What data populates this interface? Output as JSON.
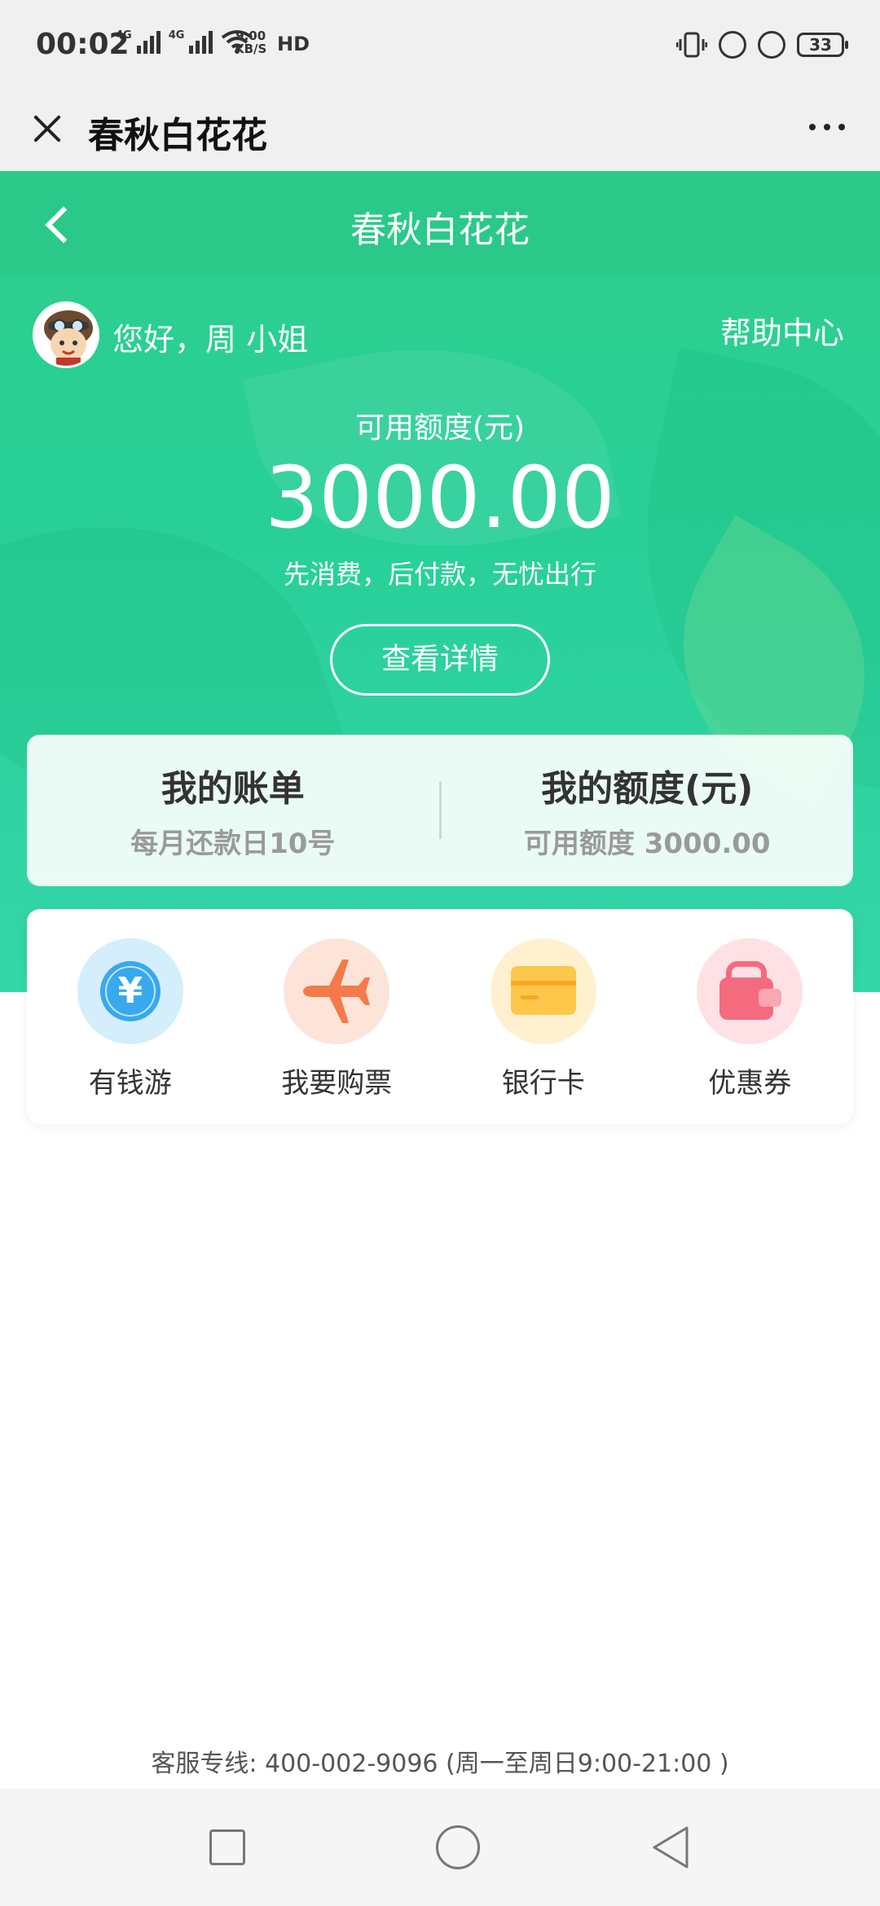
{
  "status_bar": {
    "time": "00:02",
    "network_1": "4G",
    "network_2": "4G",
    "speed_value": "9.00",
    "speed_unit": "KB/S",
    "hd": "HD",
    "battery": "33"
  },
  "wechat_bar": {
    "title": "春秋白花花"
  },
  "page_nav": {
    "title": "春秋白花花"
  },
  "user": {
    "greeting": "您好，周 小姐",
    "help_link": "帮助中心"
  },
  "credit": {
    "label": "可用额度(元)",
    "value": "3000.00",
    "slogan": "先消费，后付款，无忧出行",
    "detail_button": "查看详情"
  },
  "summary": {
    "bill_title": "我的账单",
    "bill_sub": "每月还款日10号",
    "quota_title": "我的额度(元)",
    "quota_sub": "可用额度 3000.00"
  },
  "shortcuts": {
    "items": [
      {
        "label": "有钱游",
        "icon": "yuan-coin-icon",
        "color": "#38a9ec"
      },
      {
        "label": "我要购票",
        "icon": "airplane-icon",
        "color": "#f47a4a"
      },
      {
        "label": "银行卡",
        "icon": "bank-card-icon",
        "color": "#fcc74a"
      },
      {
        "label": "优惠券",
        "icon": "wallet-icon",
        "color": "#f46a7e"
      }
    ]
  },
  "footer": {
    "hotline": "客服专线: 400-002-9096 (周一至周日9:00-21:00 )"
  },
  "colors": {
    "brand_green": "#2ac98a",
    "text_grey": "#9a9a9a"
  }
}
